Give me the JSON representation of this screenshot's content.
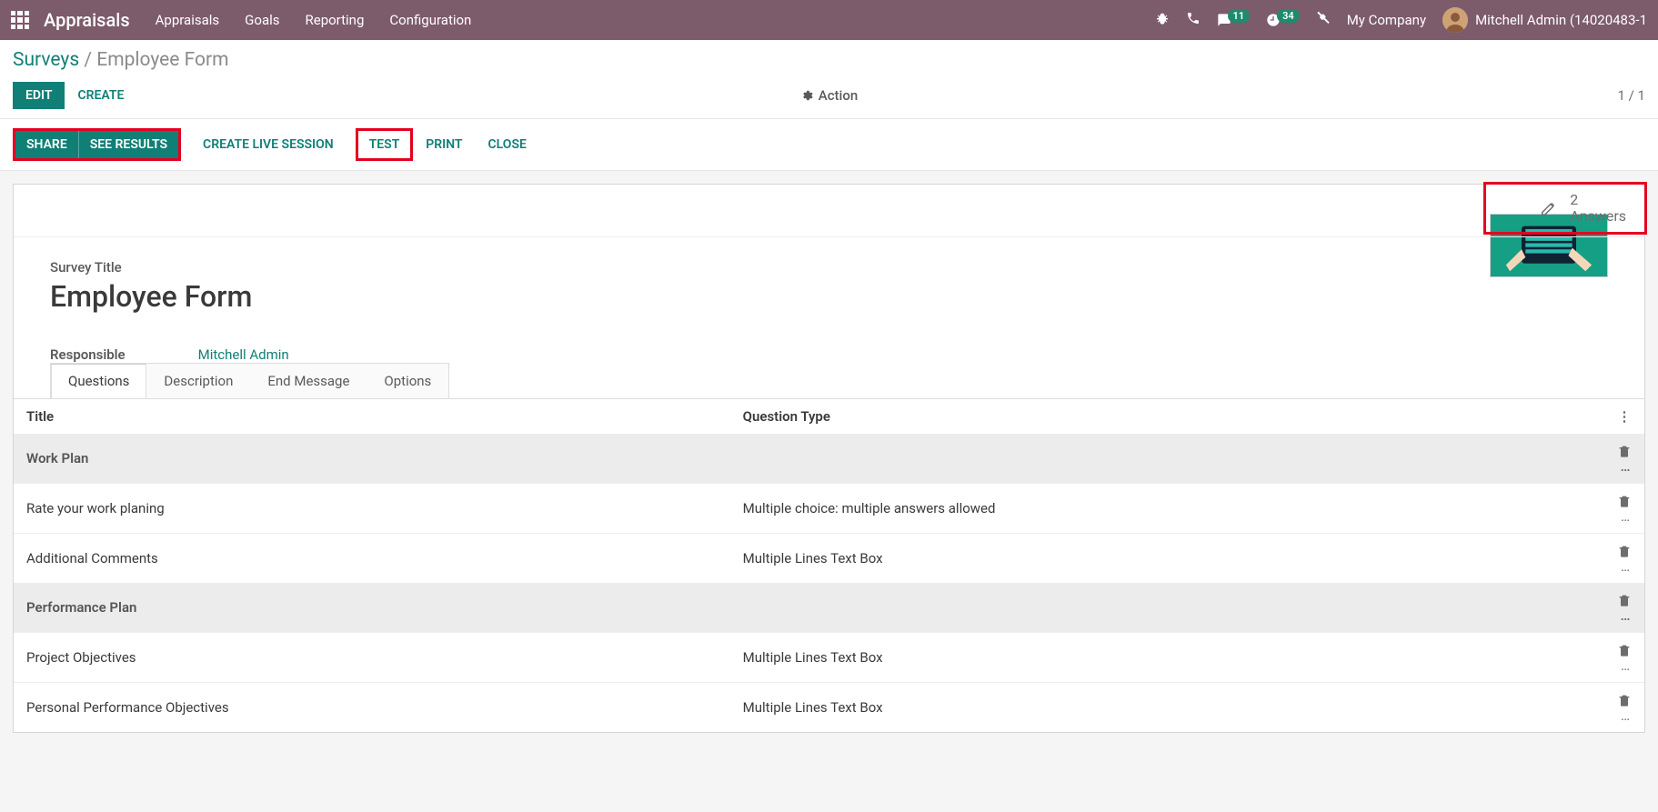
{
  "topnav": {
    "brand": "Appraisals",
    "menu": [
      "Appraisals",
      "Goals",
      "Reporting",
      "Configuration"
    ],
    "chat_badge": "11",
    "activity_badge": "34",
    "company": "My Company",
    "user": "Mitchell Admin (14020483-1"
  },
  "crumbs": {
    "parent": "Surveys",
    "current": "Employee Form"
  },
  "actionrow": {
    "edit": "EDIT",
    "create": "CREATE",
    "action": "Action",
    "pager": "1 / 1"
  },
  "statusbar": {
    "share": "SHARE",
    "see_results": "SEE RESULTS",
    "create_live": "CREATE LIVE SESSION",
    "test": "TEST",
    "print": "PRINT",
    "close": "CLOSE"
  },
  "stat": {
    "count": "2",
    "label": "Answers"
  },
  "survey": {
    "title_label": "Survey Title",
    "title": "Employee Form",
    "responsible_label": "Responsible",
    "responsible_value": "Mitchell Admin"
  },
  "tabs": {
    "questions": "Questions",
    "description": "Description",
    "end_message": "End Message",
    "options": "Options"
  },
  "table": {
    "headers": {
      "title": "Title",
      "type": "Question Type"
    },
    "rows": [
      {
        "kind": "section",
        "title": "Work Plan",
        "type": ""
      },
      {
        "kind": "row",
        "title": "Rate your work planing",
        "type": "Multiple choice: multiple answers allowed"
      },
      {
        "kind": "row",
        "title": "Additional Comments",
        "type": "Multiple Lines Text Box"
      },
      {
        "kind": "section",
        "title": "Performance Plan",
        "type": ""
      },
      {
        "kind": "row",
        "title": "Project Objectives",
        "type": "Multiple Lines Text Box"
      },
      {
        "kind": "row",
        "title": "Personal Performance Objectives",
        "type": "Multiple Lines Text Box"
      }
    ]
  }
}
